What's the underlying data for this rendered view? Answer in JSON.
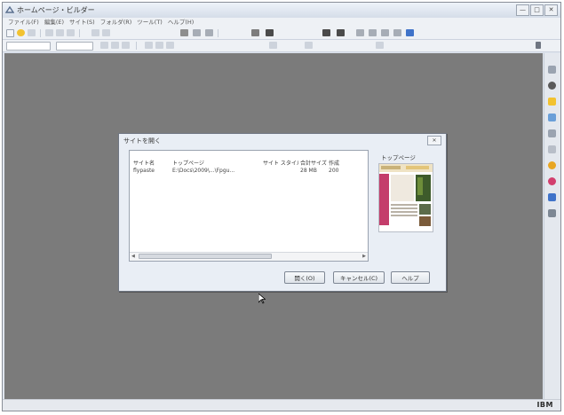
{
  "window": {
    "title": "ホームページ・ビルダー",
    "controls": [
      "—",
      "□",
      "✕"
    ]
  },
  "menu": {
    "items": [
      "ファイル(F)",
      "編集(E)",
      "サイト(S)",
      "フォルダ(R)",
      "ツール(T)",
      "ヘルプ(H)"
    ]
  },
  "dialog": {
    "title": "サイトを開く",
    "close_label": "✕",
    "columns": [
      "サイト名",
      "トップページ",
      "サイト スタイル",
      "合計サイズ",
      "作成"
    ],
    "rows": [
      {
        "name": "flypaste",
        "top_page": "E:\\Docs\\2009\\...\\Fpgu...",
        "style": "",
        "size": "28 MB",
        "created": "200"
      }
    ],
    "preview_label": "トップページ",
    "buttons": {
      "open": "開く(O)",
      "cancel": "キャンセル(C)",
      "help": "ヘルプ"
    }
  },
  "status": {
    "brand": "IBM"
  },
  "colors": {
    "workspace": "#7b7b7b",
    "chrome": "#e9eef5",
    "preview_accent": "#c43d6b"
  }
}
